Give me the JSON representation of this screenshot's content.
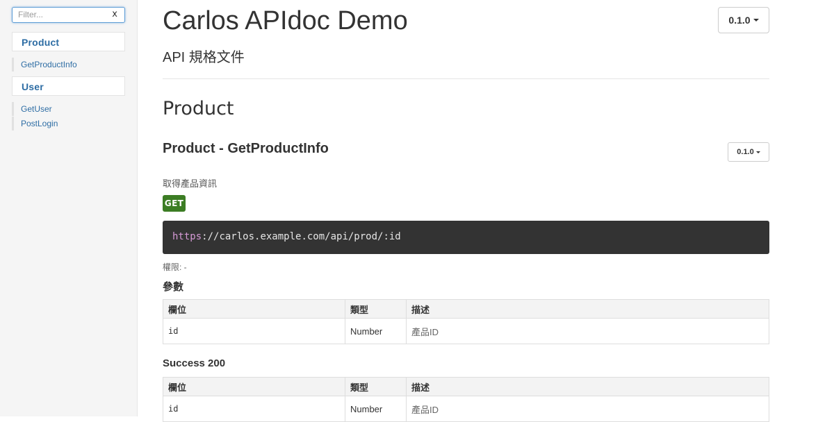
{
  "sidebar": {
    "filter_placeholder": "Filter...",
    "filter_clear": "x",
    "groups": [
      {
        "label": "Product",
        "items": [
          "GetProductInfo"
        ]
      },
      {
        "label": "User",
        "items": [
          "GetUser",
          "PostLogin"
        ]
      }
    ]
  },
  "header": {
    "title": "Carlos APIdoc Demo",
    "subtitle": "API 規格文件",
    "version": "0.1.0"
  },
  "section": {
    "title": "Product",
    "api": {
      "title": "Product - GetProductInfo",
      "version": "0.1.0",
      "description": "取得產品資訊",
      "method": "GET",
      "method_color": "#3c7d24",
      "url_protocol": "https",
      "url_rest": "://carlos.example.com/api/prod/:id",
      "permission": "權限: -",
      "params": {
        "title": "參數",
        "headers": [
          "欄位",
          "類型",
          "描述"
        ],
        "rows": [
          [
            "id",
            "Number",
            "產品ID"
          ]
        ]
      },
      "success": {
        "title": "Success 200",
        "headers": [
          "欄位",
          "類型",
          "描述"
        ],
        "rows": [
          [
            "id",
            "Number",
            "產品ID"
          ]
        ]
      }
    }
  }
}
